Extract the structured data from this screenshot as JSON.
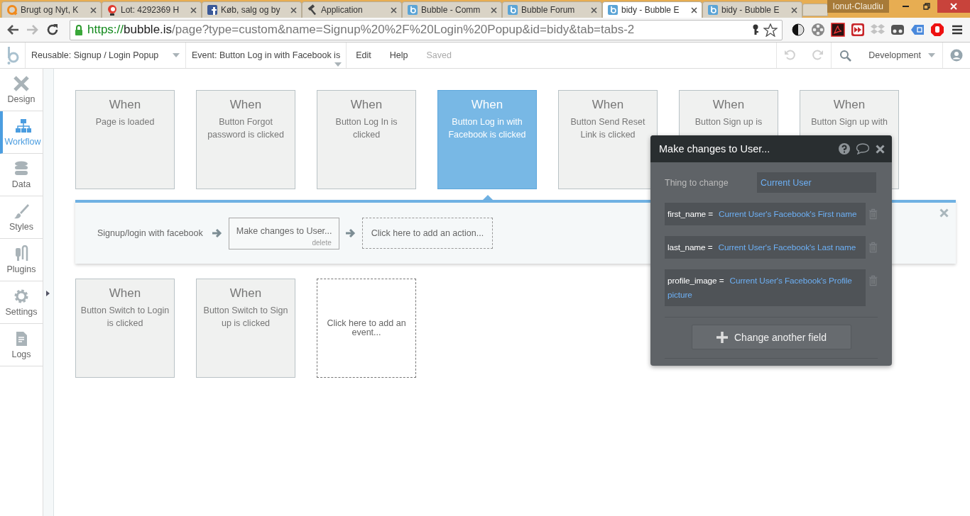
{
  "browser": {
    "tabs": [
      {
        "title": "Brugt og Nyt, K",
        "selected": false
      },
      {
        "title": "Lot: 4292369 H",
        "selected": false
      },
      {
        "title": "Køb, salg og by",
        "selected": false
      },
      {
        "title": "Application",
        "selected": false
      },
      {
        "title": "Bubble - Comm",
        "selected": false
      },
      {
        "title": "Bubble Forum",
        "selected": false
      },
      {
        "title": "bidy - Bubble E",
        "selected": true
      },
      {
        "title": "bidy - Bubble E",
        "selected": false
      }
    ],
    "profile": "Ionut-Claudiu",
    "url": {
      "scheme": "https://",
      "host": "bubble.is",
      "path": "/page?type=custom&name=Signup%20%2F%20Login%20Popup&id=bidy&tab=tabs-2"
    }
  },
  "toolbar": {
    "element": "Reusable: Signup / Login Popup",
    "event": "Event: Button Log in with Facebook is",
    "menu": [
      {
        "label": "Edit",
        "disabled": false
      },
      {
        "label": "Help",
        "disabled": false
      },
      {
        "label": "Saved",
        "disabled": true
      }
    ],
    "mode": "Development"
  },
  "sidebar": {
    "items": [
      {
        "label": "Design",
        "selected": false
      },
      {
        "label": "Workflow",
        "selected": true
      },
      {
        "label": "Data",
        "selected": false
      },
      {
        "label": "Styles",
        "selected": false
      },
      {
        "label": "Plugins",
        "selected": false
      },
      {
        "label": "Settings",
        "selected": false
      },
      {
        "label": "Logs",
        "selected": false
      }
    ]
  },
  "events_row_1": [
    {
      "kind": "event",
      "when": "When",
      "label": "Page is loaded",
      "selected": false
    },
    {
      "kind": "event",
      "when": "When",
      "label": "Button Forgot password is clicked",
      "selected": false
    },
    {
      "kind": "event",
      "when": "When",
      "label": "Button Log In is clicked",
      "selected": false
    },
    {
      "kind": "event",
      "when": "When",
      "label": "Button Log in with Facebook is clicked",
      "selected": true
    },
    {
      "kind": "event",
      "when": "When",
      "label": "Button Send Reset Link is clicked",
      "selected": false
    },
    {
      "kind": "event",
      "when": "When",
      "label": "Button Sign up is",
      "selected": false
    },
    {
      "kind": "event",
      "when": "When",
      "label": "Button Sign up with",
      "selected": false
    }
  ],
  "workflow": {
    "name": "Signup/login with facebook",
    "actions": [
      {
        "kind": "action",
        "label": "Make changes to User...",
        "delete": "delete"
      },
      {
        "kind": "add",
        "label": "Click here to add an action..."
      }
    ]
  },
  "events_row_2": [
    {
      "kind": "event",
      "when": "When",
      "label": "Button Switch to Login is clicked",
      "selected": false
    },
    {
      "kind": "event",
      "when": "When",
      "label": "Button Switch to Sign up is clicked",
      "selected": false
    },
    {
      "kind": "add",
      "label": "Click here to add an event..."
    }
  ],
  "popup": {
    "title": "Make changes to User...",
    "thing_label": "Thing to change",
    "thing_value": "Current User",
    "fields": [
      {
        "name": "first_name =",
        "value": "Current User's Facebook's First name"
      },
      {
        "name": "last_name =",
        "value": "Current User's Facebook's Last name"
      },
      {
        "name": "profile_image =",
        "value": "Current User's Facebook's Profile picture"
      }
    ],
    "button": "Change another field"
  }
}
